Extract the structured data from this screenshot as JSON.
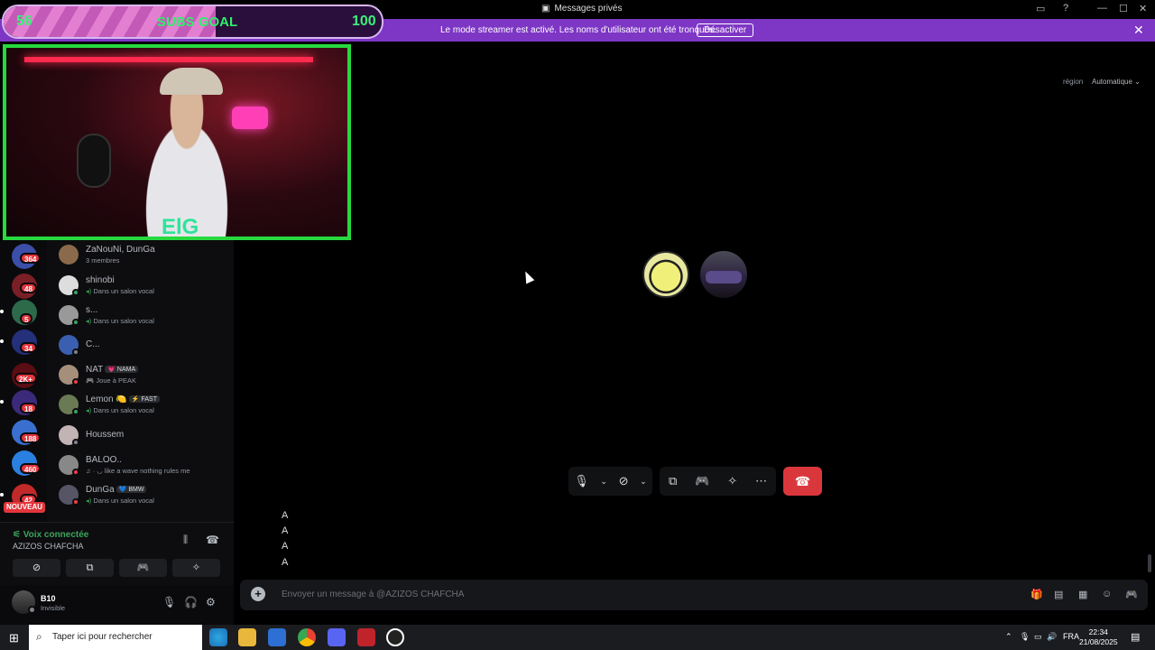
{
  "titlebar": {
    "title": "Messages privés"
  },
  "banner": {
    "message": "Le mode streamer est activé. Les noms d'utilisateur ont été tronqués.",
    "button": "Désactiver"
  },
  "subs_goal": {
    "current": "56",
    "label": "SUBS GOAL",
    "target": "100",
    "progress": 0.56
  },
  "webcam": {
    "logo_text": "ElG"
  },
  "servers": {
    "badges": [
      "364",
      "48",
      "5",
      "34",
      "2K+",
      "18",
      "188",
      "460",
      "42"
    ],
    "nouveau": "NOUVEAU"
  },
  "dms": [
    {
      "name": "ZaNouNi, DunGa",
      "sub": "3 membres",
      "avatar_color": "#8a6a4a"
    },
    {
      "name": "shinobi",
      "sub": "Dans un salon vocal",
      "avatar_color": "#ddd",
      "status": "#3ba55c"
    },
    {
      "name": "s...",
      "sub": "Dans un salon vocal",
      "avatar_color": "#999",
      "status": "#3ba55c"
    },
    {
      "name": "C...",
      "sub": "",
      "avatar_color": "#3a5fb0",
      "status": "#80848e"
    },
    {
      "name": "NAT",
      "tag": "💗 NAMA",
      "sub": "🎮 Joue à PEAK",
      "avatar_color": "#a58f7a",
      "status": "#f23f43"
    },
    {
      "name": "Lemon",
      "tag": "⚡ FAST",
      "sub": "Dans un salon vocal",
      "avatar_color": "#6a7a55",
      "status": "#3ba55c"
    },
    {
      "name": "Houssem",
      "sub": "",
      "avatar_color": "#c2b3b5",
      "status": "#80848e"
    },
    {
      "name": "BALOO..",
      "sub": "♫ · ◡ like a wave nothing rules me",
      "avatar_color": "#888",
      "status": "#f23f43"
    },
    {
      "name": "DunGa",
      "tag": "💙 BMW",
      "sub": "Dans un salon vocal",
      "avatar_color": "#556",
      "status": "#f23f43"
    }
  ],
  "voice": {
    "status": "Voix connectée",
    "channel": "AZIZOS CHAFCHA"
  },
  "user": {
    "name": "B10",
    "status": "Invisible"
  },
  "region": {
    "label": "région",
    "value": "Automatique ⌄"
  },
  "messages": [
    "A",
    "A",
    "A",
    "A"
  ],
  "composer": {
    "placeholder": "Envoyer un message à @AZIZOS CHAFCHA"
  },
  "taskbar": {
    "search_placeholder": "Taper ici pour rechercher",
    "lang": "FRA",
    "time": "22:34",
    "date": "21/08/2025"
  },
  "colors": {
    "accent": "#7e36c5",
    "danger": "#da373c",
    "online": "#3ba55c",
    "frame": "#27d93f"
  }
}
